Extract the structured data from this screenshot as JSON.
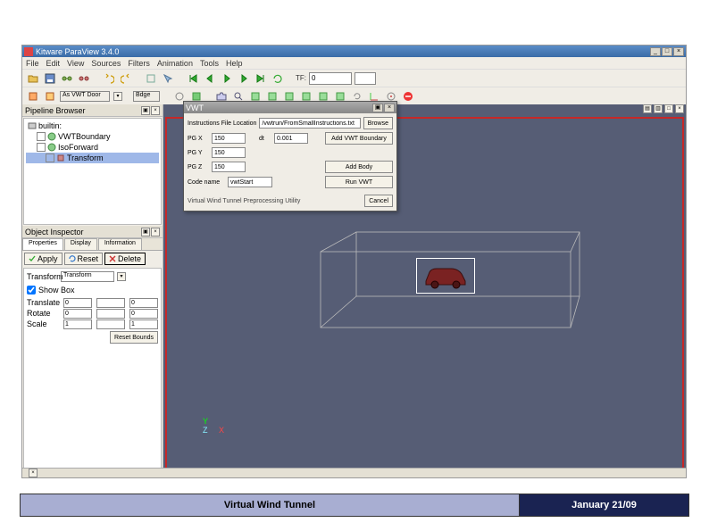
{
  "app": {
    "title": "Kitware ParaView 3.4.0"
  },
  "menu": [
    "File",
    "Edit",
    "View",
    "Sources",
    "Filters",
    "Animation",
    "Tools",
    "Help"
  ],
  "toolbar1": {
    "tf_label": "TF:",
    "tf_value": "0"
  },
  "toolbar2": {
    "item1": "As VWT Door",
    "item2": "Bdge"
  },
  "pipeline": {
    "title": "Pipeline Browser",
    "items": [
      {
        "label": "builtin:",
        "depth": 0,
        "sel": false,
        "eye": false,
        "icon": "server"
      },
      {
        "label": "VWTBoundary",
        "depth": 1,
        "sel": false,
        "eye": true,
        "icon": "geom"
      },
      {
        "label": "IsoForward",
        "depth": 1,
        "sel": false,
        "eye": true,
        "icon": "geom"
      },
      {
        "label": "Transform",
        "depth": 2,
        "sel": true,
        "eye": true,
        "icon": "filter"
      }
    ]
  },
  "inspector": {
    "title": "Object Inspector",
    "tabs": [
      "Properties",
      "Display",
      "Information"
    ],
    "apply": "Apply",
    "reset": "Reset",
    "delete": "Delete",
    "transform_label": "Transform",
    "transform_value": "Transform",
    "showbox": "Show Box",
    "rows": {
      "translate": {
        "label": "Translate",
        "x": "0",
        "y": "",
        "z": "0"
      },
      "rotate": {
        "label": "Rotate",
        "x": "0",
        "y": "",
        "z": "0"
      },
      "scale": {
        "label": "Scale",
        "x": "1",
        "y": "",
        "z": "1"
      }
    },
    "reset_bounds": "Reset Bounds"
  },
  "dialog": {
    "title": "VWT",
    "instr_label": "Instructions File Location",
    "instr_value": "/vwtrun/FromSmallInstructions.txt",
    "browse": "Browse",
    "pgx_label": "PG X",
    "pgx_value": "150",
    "pgy_label": "PG Y",
    "pgy_value": "150",
    "pgz_label": "PG Z",
    "pgz_value": "150",
    "dt_label": "dt",
    "dt_value": "0.001",
    "code_label": "Code name",
    "code_value": "vwtStart",
    "add_boundary": "Add VWT Boundary",
    "add_body": "Add Body",
    "run": "Run VWT",
    "caption": "Virtual Wind Tunnel Preprocessing Utility",
    "cancel": "Cancel"
  },
  "axis": {
    "y": "Y",
    "z": "Z",
    "x": "X"
  },
  "footer": {
    "left": "Virtual Wind Tunnel",
    "right": "January 21/09"
  },
  "win_btns": {
    "min": "_",
    "max": "□",
    "close": "×"
  }
}
